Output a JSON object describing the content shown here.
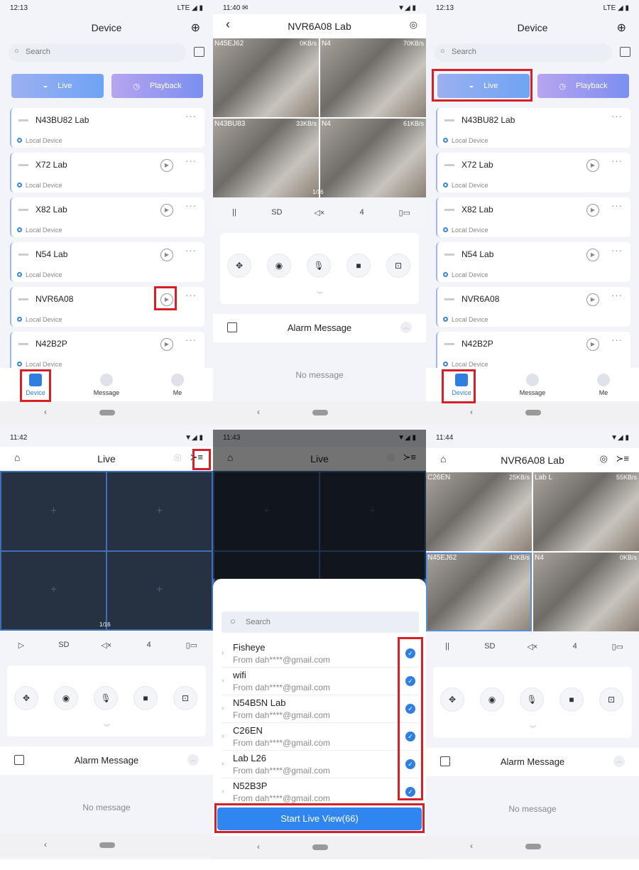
{
  "colors": {
    "accent": "#2f86f0",
    "highlight": "#d61f26",
    "live_grid": "#263142"
  },
  "device_list": {
    "title": "Device",
    "search_placeholder": "Search",
    "live_label": "Live",
    "playback_label": "Playback",
    "devices": [
      {
        "name": "N43BU82 Lab",
        "sub": "Local Device",
        "play": false
      },
      {
        "name": "X72 Lab",
        "sub": "Local Device",
        "play": true
      },
      {
        "name": "X82 Lab",
        "sub": "Local Device",
        "play": true
      },
      {
        "name": "N54 Lab",
        "sub": "Local Device",
        "play": true
      },
      {
        "name": "NVR6A08",
        "sub": "Local Device",
        "play": true
      },
      {
        "name": "N42B2P",
        "sub": "Local Device",
        "play": true
      }
    ],
    "nav": [
      "Device",
      "Message",
      "Me"
    ]
  },
  "screens": [
    {
      "time": "12:13",
      "signal": "LTE ◢ ▮"
    },
    {
      "time": "11:40 ✉",
      "signal": "▼◢ ▮",
      "title": "NVR6A08 Lab",
      "cams": [
        {
          "l": "N45EJ62",
          "r": "0KB/s"
        },
        {
          "l": "N4",
          "r": "70KB/s"
        },
        {
          "l": "N43BU83",
          "r": "33KB/s"
        },
        {
          "l": "N4",
          "r": "61KB/s"
        }
      ],
      "page": "1/16"
    },
    {
      "time": "12:13",
      "signal": "LTE ◢ ▮"
    },
    {
      "time": "11:42",
      "signal": "▼◢ ▮",
      "title": "Live",
      "page": "1/16"
    },
    {
      "time": "11:43",
      "signal": "▼◢ ▮",
      "title": "Live"
    },
    {
      "time": "11:44",
      "signal": "▼◢ ▮",
      "title": "NVR6A08 Lab",
      "cams": [
        {
          "l": "C26EN",
          "r": "25KB/s"
        },
        {
          "l": "Lab L",
          "r": "55KB/s"
        },
        {
          "l": "N45EJ62",
          "r": "42KB/s"
        },
        {
          "l": "N4",
          "r": "0KB/s"
        }
      ]
    }
  ],
  "toolbar": [
    "||",
    "SD",
    "◁×",
    "4",
    "▯▭"
  ],
  "controls": [
    "✥",
    "◉",
    "🎙",
    "■",
    "⊡"
  ],
  "alarm": {
    "title": "Alarm Message",
    "empty": "No message"
  },
  "picker": {
    "search_placeholder": "Search",
    "items": [
      {
        "name": "Fisheye",
        "from": "From dah****@gmail.com"
      },
      {
        "name": "wifi",
        "from": "From dah****@gmail.com"
      },
      {
        "name": "N54B5N Lab",
        "from": "From dah****@gmail.com"
      },
      {
        "name": "C26EN",
        "from": "From dah****@gmail.com"
      },
      {
        "name": "Lab L26",
        "from": "From dah****@gmail.com"
      },
      {
        "name": "N52B3P",
        "from": "From dah****@gmail.com"
      }
    ],
    "start_label": "Start Live View(66)"
  }
}
